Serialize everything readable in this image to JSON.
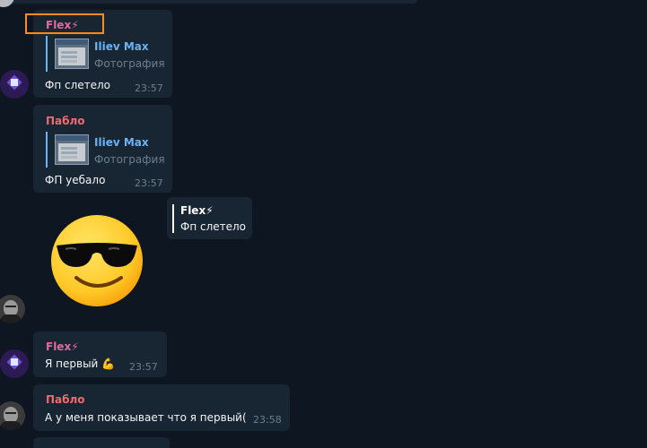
{
  "colors": {
    "background": "#0e1621",
    "bubble": "#182533",
    "flex_name": "#e36a9e",
    "pablo_name": "#f06b6b",
    "reply_accent": "#6ab2f2",
    "highlight": "#ff8a1f"
  },
  "messages": [
    {
      "sender": "Flex",
      "sender_icon": "lightning-icon",
      "reply": {
        "name": "Iliev Max",
        "subtitle": "Фотография"
      },
      "text": "Фп слетело",
      "time": "23:57"
    },
    {
      "sender": "Пабло",
      "reply": {
        "name": "Iliev Max",
        "subtitle": "Фотография"
      },
      "text": "ФП уебало",
      "time": "23:57"
    },
    {
      "type": "sticker",
      "sticker": "sunglasses-emoji",
      "reply": {
        "sender": "Flex",
        "text": "Фп слетело"
      }
    },
    {
      "sender": "Flex",
      "text": "Я первый",
      "emoji": "flexed-biceps",
      "time": "23:57"
    },
    {
      "sender": "Пабло",
      "text": "А у меня показывает что я первый(",
      "time": "23:58"
    }
  ],
  "lightning": "⚡",
  "biceps": "💪"
}
